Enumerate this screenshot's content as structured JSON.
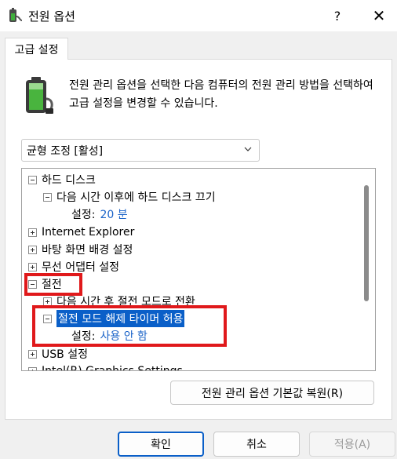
{
  "window": {
    "title": "전원 옵션",
    "help_label": "?",
    "close_label": "✕"
  },
  "tab": {
    "label": "고급 설정"
  },
  "description": "전원 관리 옵션을 선택한 다음 컴퓨터의 전원 관리 방법을 선택하여 고급 설정을 변경할 수 있습니다.",
  "plan_select": {
    "value": "균형 조정 [활성]"
  },
  "tree": {
    "hard_disk": "하드 디스크",
    "hard_disk_off": "다음 시간 이후에 하드 디스크 끄기",
    "hard_disk_setting_label": "설정:",
    "hard_disk_setting_value": "20 분",
    "ie": "Internet Explorer",
    "desktop_bg": "바탕 화면 배경 설정",
    "wireless": "무선 어댑터 설정",
    "sleep": "절전",
    "sleep_after": "다음 시간 후 절전 모드로 전환",
    "wake_timers": "절전 모드 해제 타이머 허용",
    "wake_setting_label": "설정:",
    "wake_setting_value": "사용 안 함",
    "usb": "USB 설정",
    "intel": "Intel(R) Graphics Settings"
  },
  "restore_button": "전원 관리 옵션 기본값 복원(R)",
  "buttons": {
    "ok": "확인",
    "cancel": "취소",
    "apply": "적용(A)"
  },
  "colors": {
    "highlight_box": "#e0191b",
    "selection": "#0a5fc8",
    "setting_value": "#1a63c8"
  },
  "icons": [
    "power-options-icon",
    "battery-plug-icon",
    "chevron-down-icon",
    "help-icon",
    "close-icon"
  ]
}
